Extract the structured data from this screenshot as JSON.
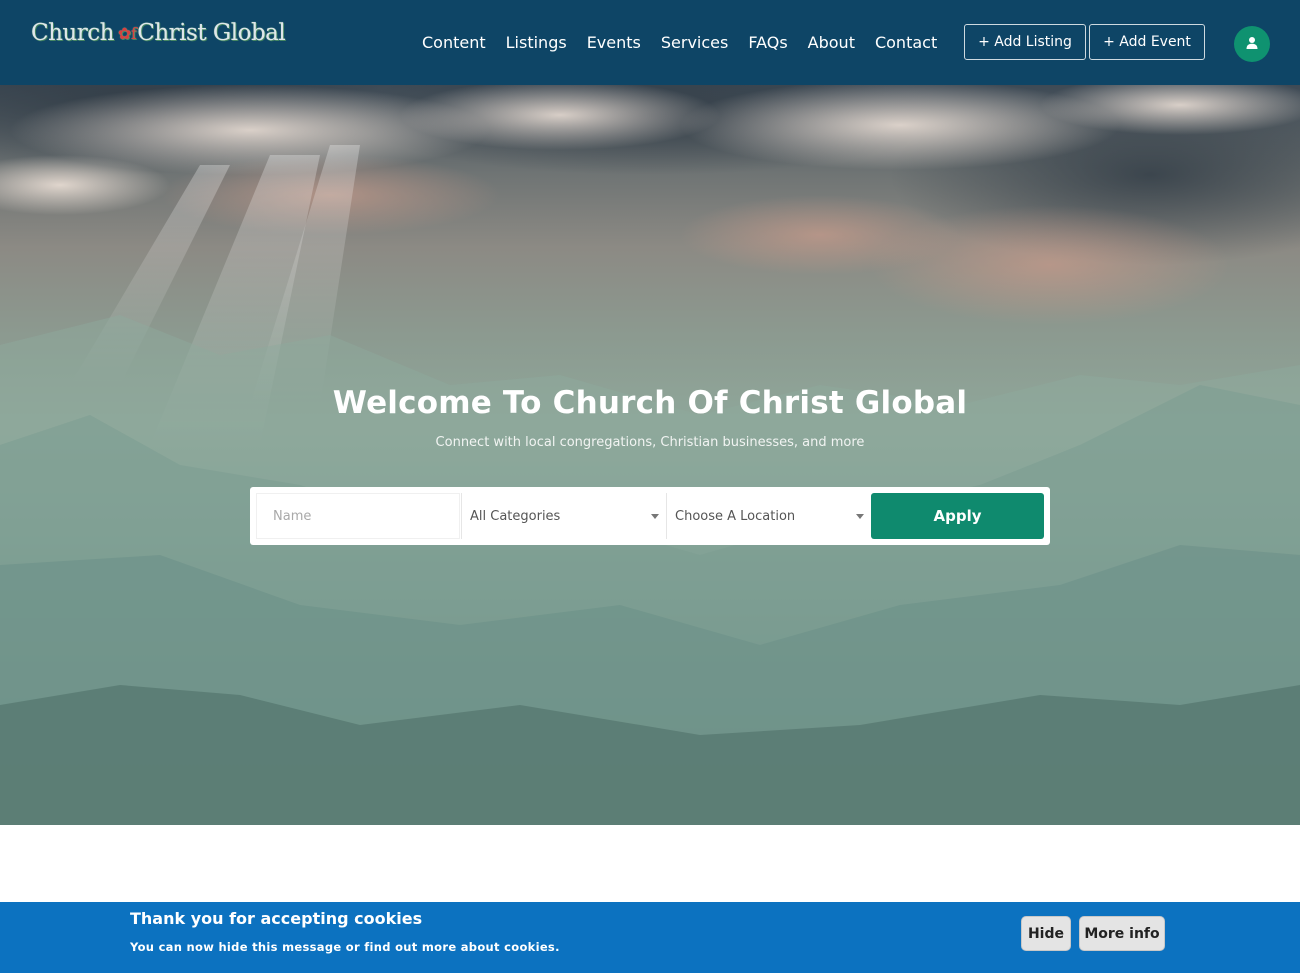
{
  "brand": {
    "logo_part1": "Church",
    "logo_mark": "✿f",
    "logo_part2": "Christ Global"
  },
  "nav": {
    "items": [
      {
        "label": "Content"
      },
      {
        "label": "Listings"
      },
      {
        "label": "Events"
      },
      {
        "label": "Services"
      },
      {
        "label": "FAQs"
      },
      {
        "label": "About"
      },
      {
        "label": "Contact"
      }
    ],
    "add_listing_label": "+ Add Listing",
    "add_event_label": "+ Add Event",
    "user_icon": "user-icon"
  },
  "hero": {
    "title": "Welcome To Church Of Christ Global",
    "subtitle": "Connect with local congregations, Christian businesses, and more"
  },
  "search": {
    "name_placeholder": "Name",
    "category_value": "All Categories",
    "location_value": "Choose A Location",
    "apply_label": "Apply"
  },
  "cookie": {
    "title": "Thank you for accepting cookies",
    "text": "You can now hide this message or find out more about cookies.",
    "hide_label": "Hide",
    "more_info_label": "More info"
  },
  "colors": {
    "header_bg": "#0e4566",
    "accent_green": "#0f8a6e",
    "avatar_green": "#0f9270",
    "cookie_bg": "#0c72c0"
  }
}
